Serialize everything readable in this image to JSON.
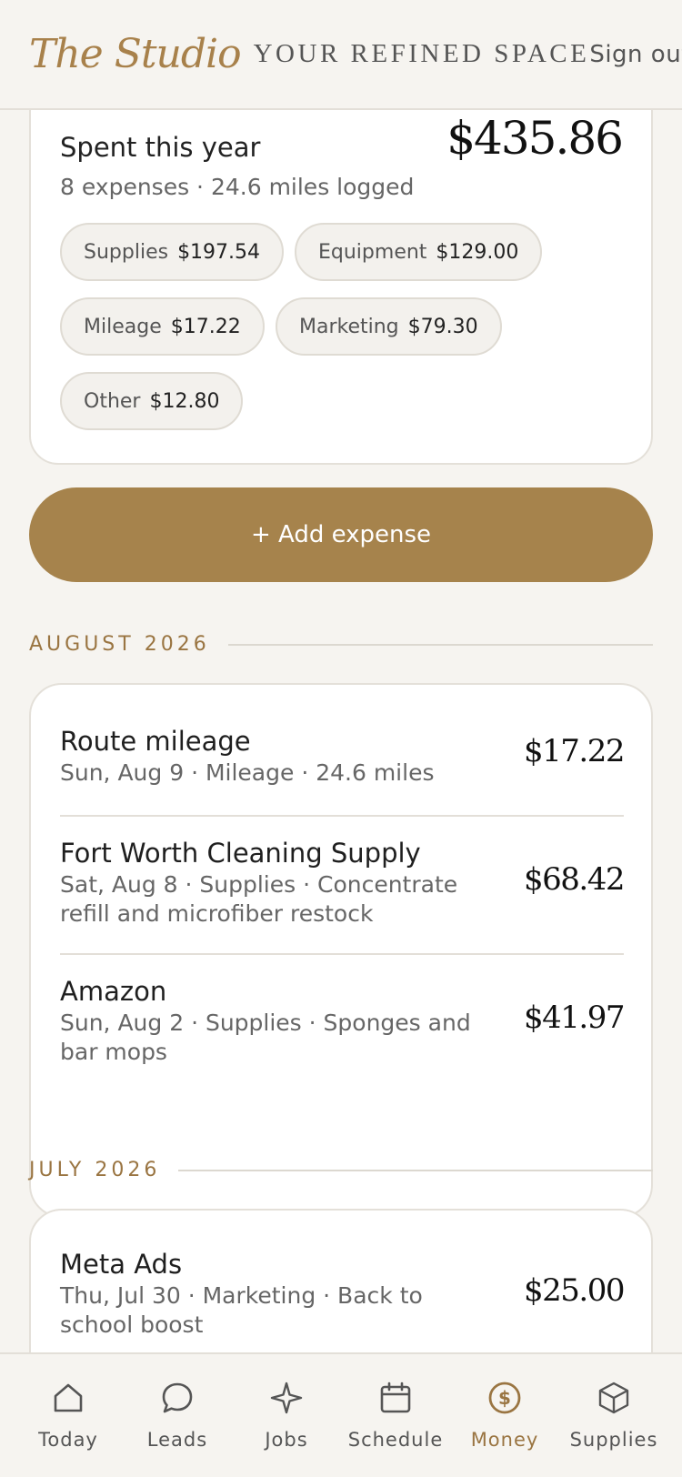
{
  "header": {
    "brand": "The Studio",
    "tagline": "YOUR REFINED SPACE",
    "signout_label": "Sign out"
  },
  "summary": {
    "title": "Spent this year",
    "total": "$435.86",
    "subtitle": "8 expenses · 24.6 miles logged",
    "categories": [
      {
        "name": "Supplies",
        "amount": "$197.54"
      },
      {
        "name": "Equipment",
        "amount": "$129.00"
      },
      {
        "name": "Mileage",
        "amount": "$17.22"
      },
      {
        "name": "Marketing",
        "amount": "$79.30"
      },
      {
        "name": "Other",
        "amount": "$12.80"
      }
    ]
  },
  "add_button_label": "+ Add expense",
  "sections": [
    {
      "heading": "AUGUST 2026",
      "items": [
        {
          "title": "Route mileage",
          "meta": "Sun, Aug 9 · Mileage · 24.6 miles",
          "amount": "$17.22"
        },
        {
          "title": "Fort Worth Cleaning Supply",
          "meta": "Sat, Aug 8 · Supplies · Concentrate refill and microfiber restock",
          "amount": "$68.42"
        },
        {
          "title": "Amazon",
          "meta": "Sun, Aug 2 · Supplies · Sponges and bar mops",
          "amount": "$41.97"
        }
      ]
    },
    {
      "heading": "JULY 2026",
      "items": [
        {
          "title": "Meta Ads",
          "meta": "Thu, Jul 30 · Marketing · Back to school boost",
          "amount": "$25.00"
        }
      ]
    }
  ],
  "tabs": [
    {
      "label": "Today",
      "icon": "home-icon",
      "active": false
    },
    {
      "label": "Leads",
      "icon": "chat-bubble-icon",
      "active": false
    },
    {
      "label": "Jobs",
      "icon": "sparkle-icon",
      "active": false
    },
    {
      "label": "Schedule",
      "icon": "calendar-icon",
      "active": false
    },
    {
      "label": "Money",
      "icon": "dollar-circle-icon",
      "active": true
    },
    {
      "label": "Supplies",
      "icon": "box-icon",
      "active": false
    }
  ],
  "colors": {
    "accent": "#a6834c",
    "accent_text": "#9a7542",
    "background": "#f6f4f0"
  }
}
